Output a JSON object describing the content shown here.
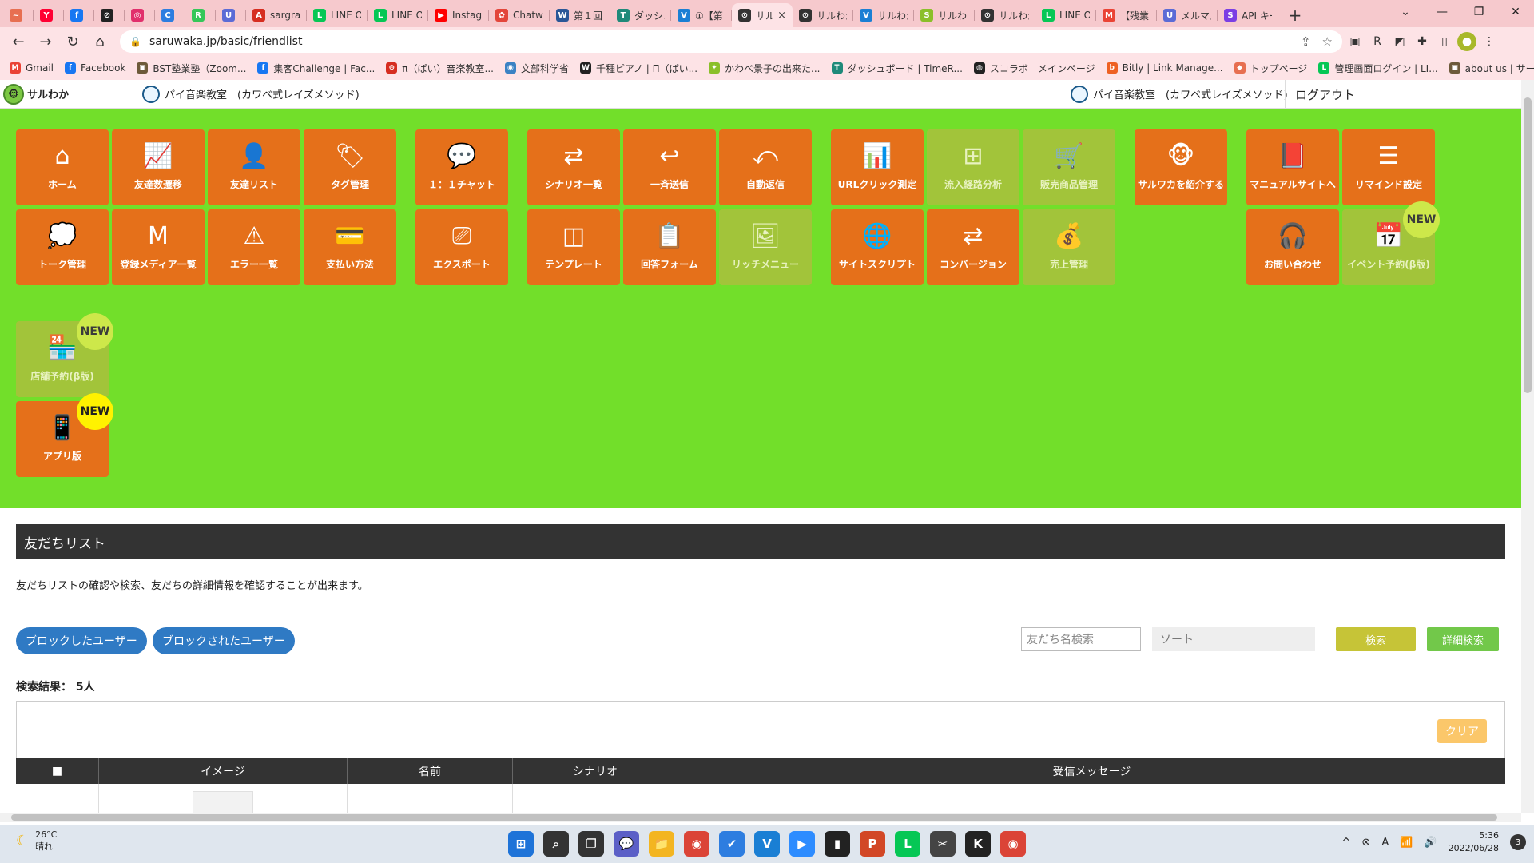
{
  "browser": {
    "tabs": [
      {
        "label": "",
        "color": "#e76f51",
        "glyph": "~"
      },
      {
        "label": "",
        "color": "#ff0033",
        "glyph": "Y"
      },
      {
        "label": "",
        "color": "#1877f2",
        "glyph": "f"
      },
      {
        "label": "",
        "color": "#222222",
        "glyph": "⊘"
      },
      {
        "label": "",
        "color": "#e1306c",
        "glyph": "◎"
      },
      {
        "label": "",
        "color": "#2d7de0",
        "glyph": "C"
      },
      {
        "label": "",
        "color": "#35c759",
        "glyph": "R"
      },
      {
        "label": "",
        "color": "#5b6bd6",
        "glyph": "U"
      },
      {
        "label": "sargran",
        "color": "#d62d20",
        "glyph": "A"
      },
      {
        "label": "LINE O",
        "color": "#06c755",
        "glyph": "L"
      },
      {
        "label": "LINE O",
        "color": "#06c755",
        "glyph": "L"
      },
      {
        "label": "Instagr",
        "color": "#ff0000",
        "glyph": "▶"
      },
      {
        "label": "Chatw",
        "color": "#e3463b",
        "glyph": "✿"
      },
      {
        "label": "第１回",
        "color": "#2b5797",
        "glyph": "W"
      },
      {
        "label": "ダッシュ",
        "color": "#1f8a7a",
        "glyph": "T"
      },
      {
        "label": "①【第",
        "color": "#1a7fd4",
        "glyph": "V"
      },
      {
        "label": "サル",
        "color": "#333333",
        "glyph": "⊙"
      },
      {
        "label": "サルわか",
        "color": "#333333",
        "glyph": "⊙"
      },
      {
        "label": "サルわか",
        "color": "#1a7fd4",
        "glyph": "V"
      },
      {
        "label": "サルわ",
        "color": "#8bbf2a",
        "glyph": "S"
      },
      {
        "label": "サルわか",
        "color": "#333333",
        "glyph": "⊙"
      },
      {
        "label": "LINE O",
        "color": "#06c755",
        "glyph": "L"
      },
      {
        "label": "【残業",
        "color": "#ea4335",
        "glyph": "M"
      },
      {
        "label": "メルマガ",
        "color": "#5b6bd6",
        "glyph": "U"
      },
      {
        "label": "API キー",
        "color": "#7b3fe4",
        "glyph": "S"
      }
    ],
    "active_tab_close": "×",
    "new_tab": "+",
    "window_controls": [
      "⌄",
      "—",
      "❐",
      "✕"
    ],
    "url": "saruwaka.jp/basic/friendlist",
    "bookmarks": [
      {
        "label": "Gmail",
        "color": "#ea4335",
        "glyph": "M"
      },
      {
        "label": "Facebook",
        "color": "#1877f2",
        "glyph": "f"
      },
      {
        "label": "BST塾業塾（Zoom...",
        "color": "#6d5a3a",
        "glyph": "▣"
      },
      {
        "label": "集客Challenge | Fac...",
        "color": "#1877f2",
        "glyph": "f"
      },
      {
        "label": "π（ぱい）音楽教室...",
        "color": "#d62d20",
        "glyph": "⊖"
      },
      {
        "label": "文部科学省",
        "color": "#3b82c4",
        "glyph": "◉"
      },
      {
        "label": "千種ピアノ | Π（ぱい...",
        "color": "#222222",
        "glyph": "W"
      },
      {
        "label": "かわべ景子の出来た...",
        "color": "#8bbf2a",
        "glyph": "✦"
      },
      {
        "label": "ダッシュボード | TimeR...",
        "color": "#1f8a7a",
        "glyph": "T"
      },
      {
        "label": "スコラボ　メインページ",
        "color": "#222222",
        "glyph": "◍"
      },
      {
        "label": "Bitly | Link Manage...",
        "color": "#ee6123",
        "glyph": "b"
      },
      {
        "label": "トップページ",
        "color": "#e76f51",
        "glyph": "◆"
      },
      {
        "label": "管理画面ログイン | LI...",
        "color": "#06c755",
        "glyph": "L"
      },
      {
        "label": "about us | サークル・...",
        "color": "#6d5a3a",
        "glyph": "▣"
      }
    ],
    "more_bookmarks": "»"
  },
  "site": {
    "logo_text": "サルわか",
    "account_name": "パイ音楽教室　(カワベ式レイズメソッド)",
    "account_name_right": "パイ音楽教室　(カワベ式レイズメソッド)",
    "logout": "ログアウト"
  },
  "menu": {
    "tiles": [
      {
        "label": "ホーム",
        "icon": "home-icon",
        "glyph": "⌂",
        "disabled": false
      },
      {
        "label": "友達数遷移",
        "icon": "line-chart-icon",
        "glyph": "📈",
        "disabled": false
      },
      {
        "label": "友達リスト",
        "icon": "user-icon",
        "glyph": "👤",
        "disabled": false
      },
      {
        "label": "タグ管理",
        "icon": "tags-icon",
        "glyph": "🏷",
        "disabled": false
      },
      {
        "label": "１：１チャット",
        "icon": "chat-icon",
        "glyph": "💬",
        "disabled": false
      },
      {
        "label": "シナリオ一覧",
        "icon": "shuffle-icon",
        "glyph": "⇄",
        "disabled": false
      },
      {
        "label": "一斉送信",
        "icon": "reply-icon",
        "glyph": "↩",
        "disabled": false
      },
      {
        "label": "自動返信",
        "icon": "undo-icon",
        "glyph": "⤺",
        "disabled": false
      },
      {
        "label": "URLクリック測定",
        "icon": "chart-search-icon",
        "glyph": "📊",
        "disabled": false
      },
      {
        "label": "流入経路分析",
        "icon": "sitemap-icon",
        "glyph": "⊞",
        "disabled": true
      },
      {
        "label": "販売商品管理",
        "icon": "cart-icon",
        "glyph": "🛒",
        "disabled": true
      },
      {
        "label": "サルワカを紹介する",
        "icon": "monkey-icon",
        "glyph": "🐵",
        "disabled": false
      },
      {
        "label": "マニュアルサイトへ",
        "icon": "book-icon",
        "glyph": "📕",
        "disabled": false
      },
      {
        "label": "リマインド設定",
        "icon": "list-icon",
        "glyph": "☰",
        "disabled": false
      },
      {
        "label": "トーク管理",
        "icon": "speech-bubble-icon",
        "glyph": "💭",
        "disabled": false
      },
      {
        "label": "登録メディア一覧",
        "icon": "media-icon",
        "glyph": "M",
        "disabled": false
      },
      {
        "label": "エラー一覧",
        "icon": "warning-icon",
        "glyph": "⚠",
        "disabled": false
      },
      {
        "label": "支払い方法",
        "icon": "credit-card-icon",
        "glyph": "💳",
        "disabled": false
      },
      {
        "label": "エクスポート",
        "icon": "hdd-icon",
        "glyph": "⎚",
        "disabled": false
      },
      {
        "label": "テンプレート",
        "icon": "columns-icon",
        "glyph": "◫",
        "disabled": false
      },
      {
        "label": "回答フォーム",
        "icon": "clipboard-icon",
        "glyph": "📋",
        "disabled": false
      },
      {
        "label": "リッチメニュー",
        "icon": "image-icon",
        "glyph": "🖼",
        "disabled": true
      },
      {
        "label": "サイトスクリプト",
        "icon": "www-icon",
        "glyph": "🌐",
        "disabled": false
      },
      {
        "label": "コンバージョン",
        "icon": "exchange-icon",
        "glyph": "⇄",
        "disabled": false
      },
      {
        "label": "売上管理",
        "icon": "money-bag-icon",
        "glyph": "💰",
        "disabled": true
      },
      {
        "label": "お問い合わせ",
        "icon": "headset-icon",
        "glyph": "🎧",
        "disabled": false
      },
      {
        "label": "イベント予約(β版)",
        "icon": "calendar-icon",
        "glyph": "📅",
        "disabled": true
      },
      {
        "label": "店舗予約(β版)",
        "icon": "store-icon",
        "glyph": "🏪",
        "disabled": true
      },
      {
        "label": "アプリ版",
        "icon": "mobile-icon",
        "glyph": "📱",
        "disabled": false
      }
    ],
    "badge_new": "NEW"
  },
  "friendlist": {
    "title": "友だちリスト",
    "description": "友だちリストの確認や検索、友だちの詳細情報を確認することが出来ます。",
    "blocked_by_me": "ブロックしたユーザー",
    "blocked_me": "ブロックされたユーザー",
    "search_placeholder": "友だち名検索",
    "sort_placeholder": "ソート",
    "search_button": "検索",
    "advanced_search_button": "詳細検索",
    "results_label": "検索結果：",
    "results_count": "5人",
    "clear_button": "クリア",
    "columns": [
      "■",
      "イメージ",
      "名前",
      "シナリオ",
      "受信メッセージ"
    ]
  },
  "taskbar": {
    "temperature": "26°C",
    "weather": "晴れ",
    "time": "5:36",
    "date": "2022/06/28",
    "notifications": "3",
    "apps": [
      {
        "name": "windows-start-icon",
        "glyph": "⊞",
        "color": "#1e73d8"
      },
      {
        "name": "search-icon",
        "glyph": "⌕",
        "color": "#333333"
      },
      {
        "name": "task-view-icon",
        "glyph": "❐",
        "color": "#333333"
      },
      {
        "name": "teams-chat-icon",
        "glyph": "💬",
        "color": "#5b5fc7"
      },
      {
        "name": "file-explorer-icon",
        "glyph": "📁",
        "color": "#f3b521"
      },
      {
        "name": "chrome-icon",
        "glyph": "◉",
        "color": "#db4437"
      },
      {
        "name": "todo-icon",
        "glyph": "✔",
        "color": "#2d7de0"
      },
      {
        "name": "vimeo-icon",
        "glyph": "V",
        "color": "#1a7fd4"
      },
      {
        "name": "zoom-icon",
        "glyph": "▶",
        "color": "#2d8cff"
      },
      {
        "name": "sticky-notes-icon",
        "glyph": "▮",
        "color": "#222222"
      },
      {
        "name": "powerpoint-icon",
        "glyph": "P",
        "color": "#d24726"
      },
      {
        "name": "line-icon",
        "glyph": "L",
        "color": "#06c755"
      },
      {
        "name": "snipping-icon",
        "glyph": "✂",
        "color": "#444444"
      },
      {
        "name": "kindle-icon",
        "glyph": "K",
        "color": "#222222"
      },
      {
        "name": "chrome-alt-icon",
        "glyph": "◉",
        "color": "#db4437"
      }
    ],
    "tray": [
      "^",
      "⊗",
      "A",
      "📶",
      "🔊"
    ]
  }
}
